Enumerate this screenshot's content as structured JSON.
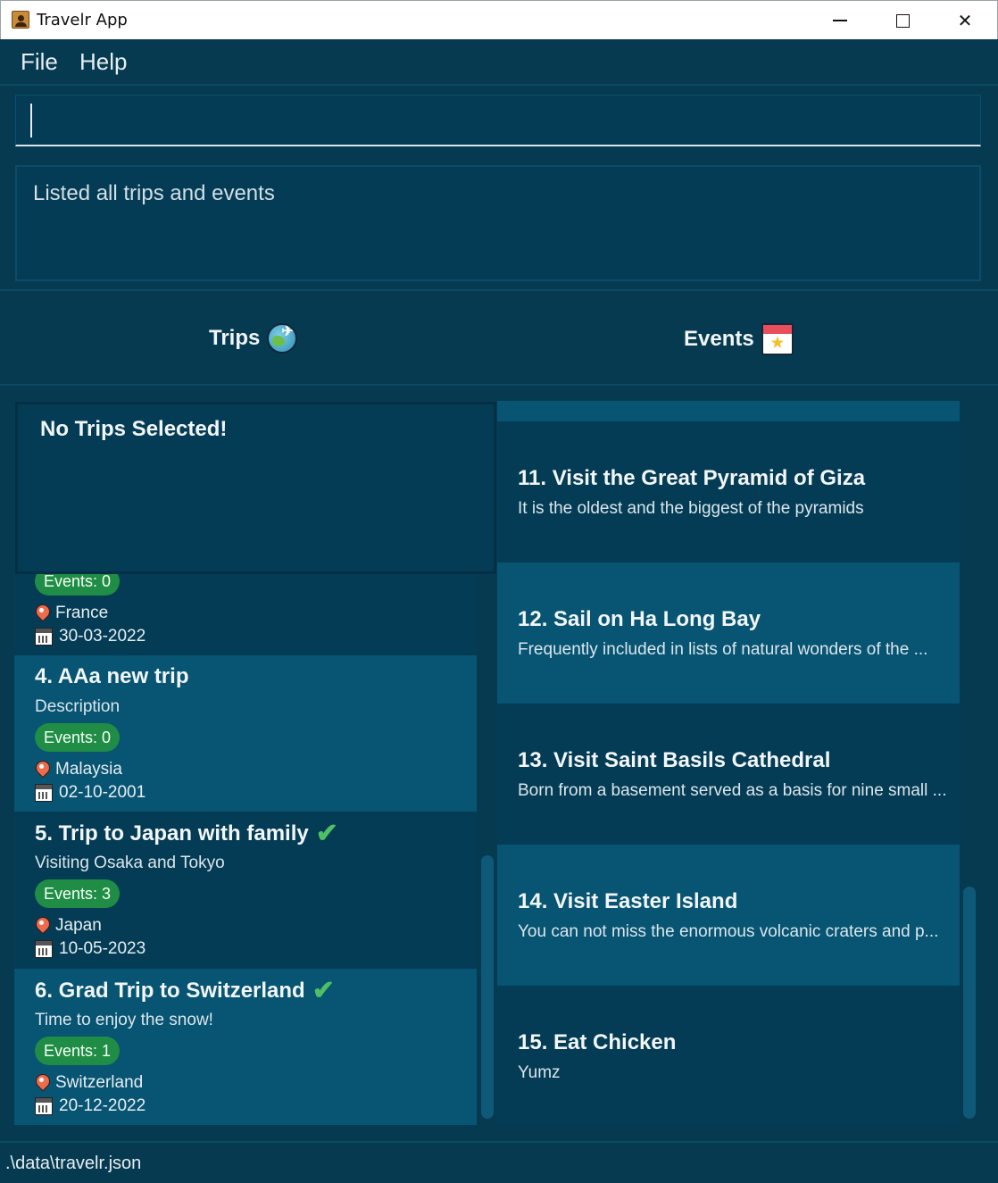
{
  "window": {
    "title": "Travelr App",
    "minimize_icon": "minimize-icon",
    "maximize_icon": "maximize-icon",
    "close_icon": "close-icon"
  },
  "menu": {
    "file": "File",
    "help": "Help"
  },
  "command": {
    "value": ""
  },
  "result": {
    "text": "Listed all trips and events"
  },
  "headers": {
    "trips": "Trips",
    "events": "Events",
    "trips_icon": "globe-plane-icon",
    "events_icon": "calendar-star-icon"
  },
  "popup": {
    "text": "No Trips Selected!"
  },
  "trips": [
    {
      "title": "",
      "description": "",
      "events": "Events: 0",
      "location": "France",
      "date": "30-03-2022",
      "completed": false
    },
    {
      "title": "4.  AAa new trip",
      "description": "Description",
      "events": "Events: 0",
      "location": "Malaysia",
      "date": "02-10-2001",
      "completed": false
    },
    {
      "title": "5.  Trip to Japan with family",
      "description": "Visiting Osaka and Tokyo",
      "events": "Events: 3",
      "location": "Japan",
      "date": "10-05-2023",
      "completed": true
    },
    {
      "title": "6.  Grad Trip to Switzerland",
      "description": "Time to enjoy the snow!",
      "events": "Events: 1",
      "location": "Switzerland",
      "date": "20-12-2022",
      "completed": true
    }
  ],
  "events": [
    {
      "title": "11.  Visit the Great Pyramid of Giza",
      "description": "It is the oldest and the biggest of the pyramids"
    },
    {
      "title": "12.  Sail on Ha Long Bay",
      "description": "Frequently included in lists of natural wonders of the ..."
    },
    {
      "title": "13.  Visit Saint Basils Cathedral",
      "description": "Born from a basement served as a basis for nine small ..."
    },
    {
      "title": "14.  Visit Easter Island",
      "description": "You can not miss the enormous volcanic craters and p..."
    },
    {
      "title": "15.  Eat Chicken",
      "description": "Yumz"
    }
  ],
  "status": {
    "path": ".\\data\\travelr.json"
  },
  "colors": {
    "background": "#063a50",
    "card_dark": "#043c55",
    "card_light": "#075473",
    "badge": "#1f8d45",
    "check": "#4fbf65"
  }
}
